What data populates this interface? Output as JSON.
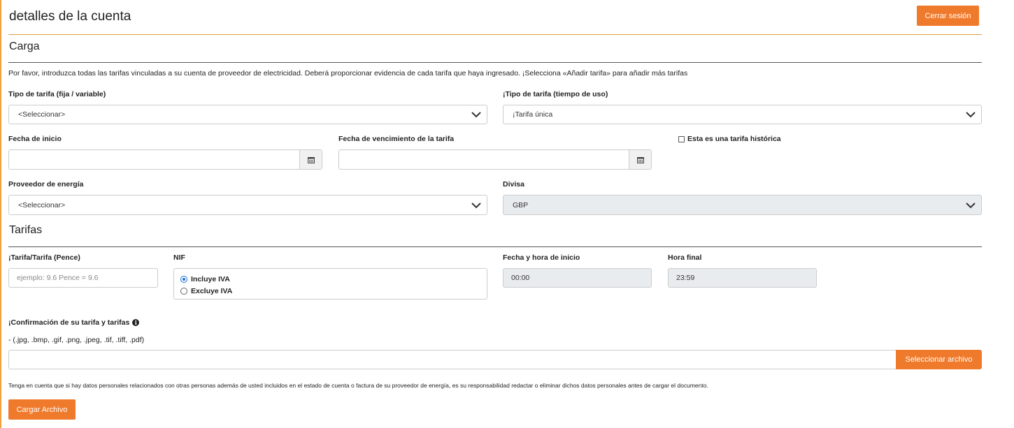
{
  "header": {
    "title": "detalles de la cuenta",
    "logout_label": "Cerrar sesión"
  },
  "upload_section": {
    "title": "Carga",
    "intro": "Por favor, introduzca todas las tarifas vinculadas a su cuenta de proveedor de electricidad. Deberá proporcionar evidencia de cada tarifa que haya ingresado. ¡Selecciona «Añadir tarifa» para añadir más tarifas",
    "tariff_type_label": "Tipo de tarifa (fija / variable)",
    "tariff_type_value": "<Seleccionar>",
    "tou_label": "¡Tipo de tarifa (tiempo de uso)",
    "tou_value": "¡Tarifa única",
    "start_date_label": "Fecha de inicio",
    "start_date_value": "",
    "expiry_date_label": "Fecha de vencimiento de la tarifa",
    "expiry_date_value": "",
    "historic_label": "Esta es una tarifa histórica",
    "historic_checked": false,
    "provider_label": "Proveedor de energía",
    "provider_value": "<Seleccionar>",
    "currency_label": "Divisa",
    "currency_value": "GBP"
  },
  "tariffs_section": {
    "title": "Tarifas",
    "rate_label": "¡Tarifa/Tarifa (Pence)",
    "rate_placeholder": "ejemplo: 9.6 Pence = 9.6",
    "nif_label": "NIF",
    "vat_options": [
      {
        "label": "Incluye IVA",
        "checked": true
      },
      {
        "label": "Excluye IVA",
        "checked": false
      }
    ],
    "start_time_label": "Fecha y hora de inicio",
    "start_time_value": "00:00",
    "end_time_label": "Hora final",
    "end_time_value": "23:59",
    "confirmation_label": "¡Confirmación de su tarifa y tarifas",
    "file_types": "- (.jpg, .bmp, .gif, .png, .jpeg, .tif, .tiff, .pdf)",
    "file_value": "",
    "select_file_label": "Seleccionar archivo",
    "privacy_note": "Tenga en cuenta que si hay datos personales relacionados con otras personas además de usted incluidos en el estado de cuenta o factura de su proveedor de energía, es su responsabilidad redactar o eliminar dichos datos personales antes de cargar el documento.",
    "upload_label": "Cargar Archivo"
  },
  "icons": {
    "calendar": "calendar-icon",
    "chevron": "chevron-down-icon",
    "info": "info-icon"
  },
  "colors": {
    "accent": "#f07a2b",
    "divider": "#e0a040",
    "radio_checked": "#1a6fd6",
    "disabled_bg": "#e9ecef"
  }
}
